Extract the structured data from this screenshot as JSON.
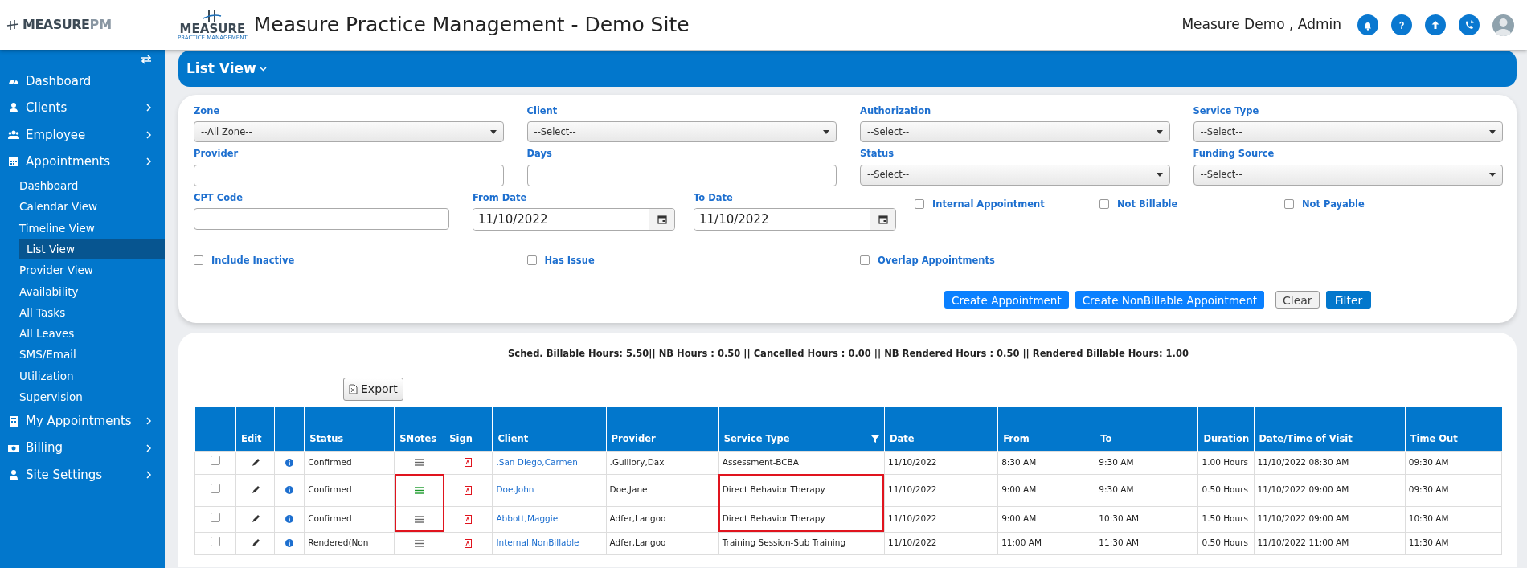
{
  "header": {
    "brand": {
      "name": "MEASURE",
      "suffix": "PM"
    },
    "logo": {
      "name": "MEASURE",
      "tagline": "PRACTICE MANAGEMENT"
    },
    "title": "Measure Practice Management - Demo Site",
    "user": "Measure Demo , Admin"
  },
  "sidebar": {
    "items": [
      {
        "label": "Dashboard",
        "selected": false
      },
      {
        "label": "Clients",
        "selected": false
      },
      {
        "label": "Employee",
        "selected": false
      },
      {
        "label": "Appointments",
        "selected": false,
        "children": [
          {
            "label": "Dashboard",
            "selected": false
          },
          {
            "label": "Calendar View",
            "selected": false
          },
          {
            "label": "Timeline View",
            "selected": false
          },
          {
            "label": "List View",
            "selected": true
          },
          {
            "label": "Provider View",
            "selected": false
          },
          {
            "label": "Availability",
            "selected": false
          },
          {
            "label": "All Tasks",
            "selected": false
          },
          {
            "label": "All Leaves",
            "selected": false
          },
          {
            "label": "SMS/Email",
            "selected": false
          },
          {
            "label": "Utilization",
            "selected": false
          },
          {
            "label": "Supervision",
            "selected": false
          }
        ]
      },
      {
        "label": "My Appointments",
        "selected": false
      },
      {
        "label": "Billing",
        "selected": false
      },
      {
        "label": "Site Settings",
        "selected": false
      }
    ]
  },
  "page_title": "List View",
  "filters": {
    "rows": [
      [
        {
          "kind": "select",
          "label": "Zone",
          "value": "--All Zone--"
        },
        {
          "kind": "select",
          "label": "Client",
          "value": "--Select--"
        },
        {
          "kind": "select",
          "label": "Authorization",
          "value": "--Select--"
        },
        {
          "kind": "select",
          "label": "Service Type",
          "value": "--Select--"
        }
      ],
      [
        {
          "kind": "text",
          "label": "Provider"
        },
        {
          "kind": "text",
          "label": "Days"
        },
        {
          "kind": "select",
          "label": "Status",
          "value": "--Select--"
        },
        {
          "kind": "select",
          "label": "Funding Source",
          "value": "--Select--"
        }
      ],
      [
        {
          "kind": "text",
          "label": "CPT Code"
        },
        {
          "kind": "date",
          "label": "From Date",
          "value": "11/10/2022"
        },
        {
          "kind": "date",
          "label": "To Date",
          "value": "11/10/2022"
        },
        {
          "kind": "checkbox",
          "label": "Internal Appointment",
          "checked": false
        },
        {
          "kind": "checkbox",
          "label": "Not Billable",
          "checked": false
        },
        {
          "kind": "checkbox",
          "label": "Not Payable",
          "checked": false
        }
      ],
      [
        {
          "kind": "checkbox",
          "label": "Include Inactive",
          "checked": false
        },
        {
          "kind": "checkbox",
          "label": "Has Issue",
          "checked": false
        },
        {
          "kind": "checkbox",
          "label": "Overlap Appointments",
          "checked": false
        }
      ]
    ],
    "buttons": [
      {
        "label": "Create Appointment",
        "kind": "primary"
      },
      {
        "label": "Create NonBillable Appointment",
        "kind": "primary"
      },
      {
        "label": "Clear",
        "kind": "light"
      },
      {
        "label": "Filter",
        "kind": "dark"
      }
    ]
  },
  "summary": "Sched. Billable Hours: 5.50|| NB Hours : 0.50 || Cancelled Hours : 0.00 || NB Rendered Hours : 0.50 || Rendered Billable Hours: 1.00",
  "export_button": "Export",
  "table": {
    "columns": [
      {
        "kind": "select",
        "marked": false
      },
      {
        "kind": "edit",
        "label": "Edit",
        "marked": false
      },
      {
        "kind": "info",
        "marked": false
      },
      {
        "kind": "text",
        "label": "Status",
        "marked": false
      },
      {
        "kind": "notes",
        "label": "SNotes",
        "marked": true
      },
      {
        "kind": "sign",
        "label": "Sign",
        "marked": false
      },
      {
        "kind": "link",
        "label": "Client",
        "marked": false
      },
      {
        "kind": "text",
        "label": "Provider",
        "marked": false
      },
      {
        "kind": "text",
        "label": "Service Type",
        "filter": true,
        "marked": true
      },
      {
        "kind": "text",
        "label": "Date",
        "marked": false
      },
      {
        "kind": "text",
        "label": "From",
        "marked": false
      },
      {
        "kind": "text",
        "label": "To",
        "marked": false
      },
      {
        "kind": "text",
        "label": "Duration",
        "marked": false
      },
      {
        "kind": "text",
        "label": "Date/Time of Visit",
        "marked": false
      },
      {
        "kind": "text",
        "label": "Time Out",
        "marked": false
      }
    ],
    "rows": [
      {
        "checked": false,
        "marked": false,
        "notes_filled": false,
        "cells": [
          "",
          "",
          "",
          "Confirmed",
          "",
          "",
          ".San Diego,Carmen",
          ".Guillory,Dax",
          "Assessment-BCBA",
          "11/10/2022",
          "8:30 AM",
          "9:30 AM",
          "1.00 Hours",
          "11/10/2022 08:30 AM",
          "09:30 AM"
        ]
      },
      {
        "checked": false,
        "marked": true,
        "notes_filled": true,
        "cells": [
          "",
          "",
          "",
          "Confirmed",
          "",
          "",
          "Doe,John",
          "Doe,Jane",
          "Direct Behavior Therapy",
          "11/10/2022",
          "9:00 AM",
          "9:30 AM",
          "0.50 Hours",
          "11/10/2022 09:00 AM",
          "09:30 AM"
        ]
      },
      {
        "checked": false,
        "marked": true,
        "notes_filled": false,
        "cells": [
          "",
          "",
          "",
          "Confirmed",
          "",
          "",
          "Abbott,Maggie",
          "Adfer,Langoo",
          "Direct Behavior Therapy",
          "11/10/2022",
          "9:00 AM",
          "10:30 AM",
          "1.50 Hours",
          "11/10/2022 09:00 AM",
          "10:30 AM"
        ]
      },
      {
        "checked": false,
        "marked": false,
        "notes_filled": false,
        "cells": [
          "",
          "",
          "",
          "Rendered(Non",
          "",
          "",
          "Internal,NonBillable",
          "Adfer,Langoo",
          "Training Session-Sub Training",
          "11/10/2022",
          "11:00 AM",
          "11:30 AM",
          "0.50 Hours",
          "11/10/2022 11:00 AM",
          "11:30 AM"
        ]
      }
    ]
  }
}
